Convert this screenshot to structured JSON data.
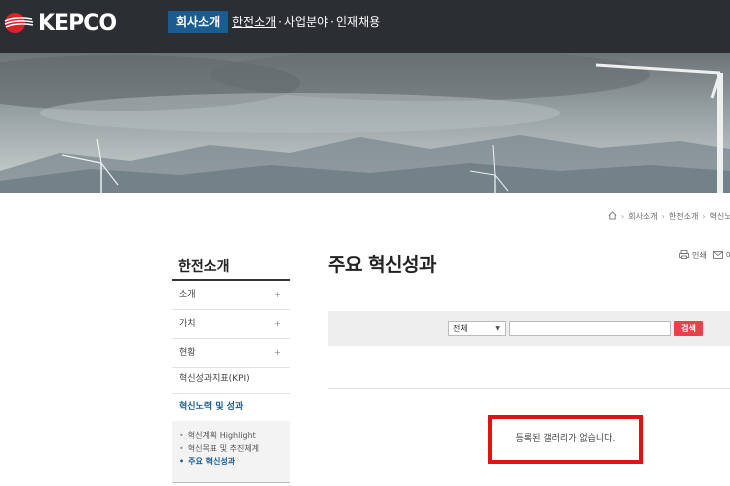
{
  "header": {
    "logo_text": "KEPCO",
    "nav_active": "회사소개",
    "nav_links": [
      "한전소개",
      "사업분야",
      "인재채용"
    ],
    "nav_separator": "·"
  },
  "breadcrumb": [
    "회사소개",
    "한전소개",
    "혁신노력"
  ],
  "sidebar": {
    "title": "한전소개",
    "items": [
      {
        "label": "소개",
        "expand": "+"
      },
      {
        "label": "가치",
        "expand": "+"
      },
      {
        "label": "현황",
        "expand": "+"
      },
      {
        "label": "혁신성과지표(KPI)",
        "expand": ""
      },
      {
        "label": "혁신노력 및 성과",
        "expand": ""
      }
    ],
    "subitems": [
      {
        "label": "혁신계획 Highlight",
        "bullet": "•"
      },
      {
        "label": "혁신목표 및 추진체계",
        "bullet": "•"
      },
      {
        "label": "주요 혁신성과",
        "bullet": "•"
      }
    ]
  },
  "main": {
    "title": "주요 혁신성과",
    "tools": {
      "print_label": "인쇄",
      "email_label": "이"
    },
    "search": {
      "select_value": "전체",
      "input_value": "",
      "button_label": "검색"
    },
    "empty_message": "등록된 갤러리가 없습니다."
  },
  "colors": {
    "header_bg": "#2b2e33",
    "nav_active_bg": "#1a5c8f",
    "search_button": "#e8414c",
    "highlight_border": "#e31212"
  }
}
